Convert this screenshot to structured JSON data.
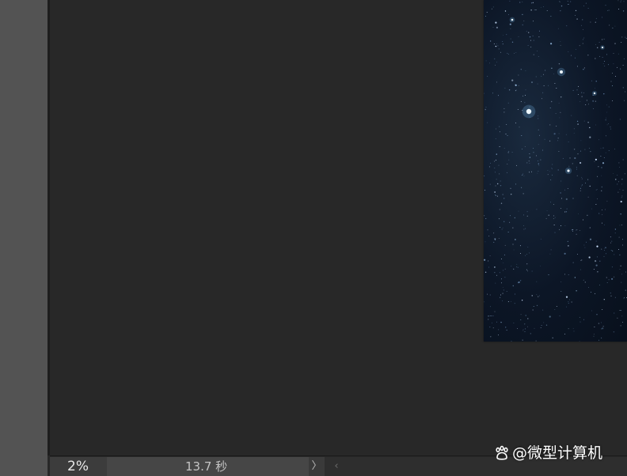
{
  "status_bar": {
    "zoom": "2%",
    "doc_info": "13.7 秒",
    "arrow_glyph": "〉",
    "scroll_left_glyph": "‹"
  },
  "watermark": {
    "text": "@微型计算机"
  },
  "colors": {
    "canvas_bg": "#282828",
    "toolbar_bg": "#535353",
    "status_zoom_bg": "#3c3c3c",
    "status_info_bg": "#464646",
    "sky": "#0c1626"
  }
}
